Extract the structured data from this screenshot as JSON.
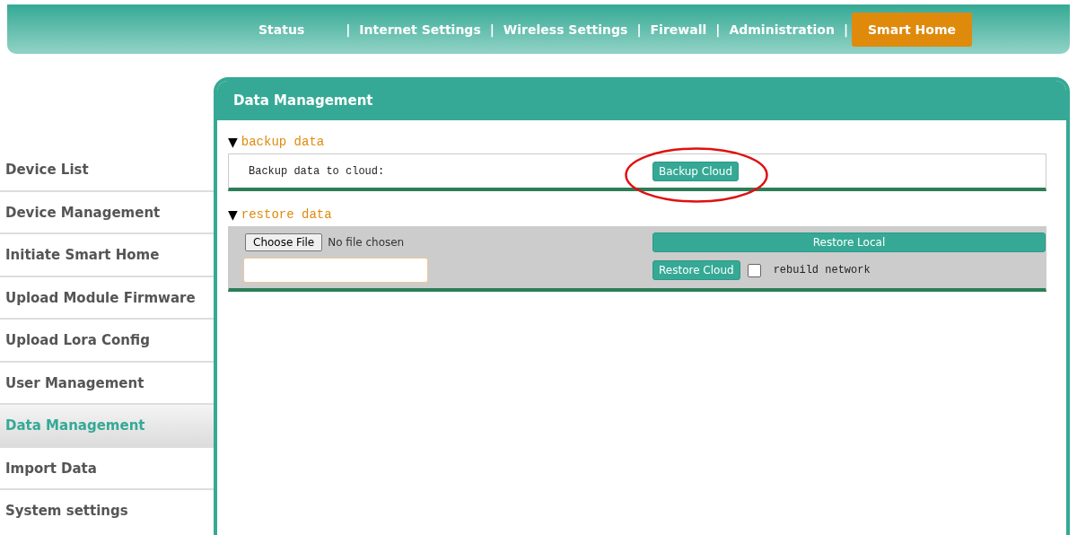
{
  "nav": [
    {
      "label": "Status",
      "selected": false,
      "divider": "|"
    },
    {
      "label": "Internet Settings",
      "selected": false,
      "divider": "|"
    },
    {
      "label": "Wireless Settings",
      "selected": false,
      "divider": "|"
    },
    {
      "label": "Firewall",
      "selected": false,
      "divider": "|"
    },
    {
      "label": "Administration",
      "selected": false,
      "divider": "|"
    },
    {
      "label": "Smart Home",
      "selected": true
    }
  ],
  "sidebar": {
    "items": [
      {
        "label": "Device List",
        "selected": false
      },
      {
        "label": "Device Management",
        "selected": false
      },
      {
        "label": "Initiate Smart Home",
        "selected": false
      },
      {
        "label": "Upload Module Firmware",
        "selected": false
      },
      {
        "label": "Upload Lora Config",
        "selected": false
      },
      {
        "label": "User Management",
        "selected": false
      },
      {
        "label": "Data Management",
        "selected": true
      },
      {
        "label": "Import Data",
        "selected": false
      },
      {
        "label": "System settings",
        "selected": false
      }
    ]
  },
  "panel": {
    "title": "Data Management",
    "backup": {
      "toggle": "▼",
      "title": "backup data",
      "label": "Backup data to cloud:",
      "button": {
        "label": "Backup Cloud",
        "highlighted": true
      }
    },
    "restore": {
      "toggle": "▼",
      "title": "restore data",
      "file_button": "Choose File",
      "file_status": "No file chosen",
      "restore_local": "Restore Local",
      "restore_cloud": "Restore Cloud",
      "rebuild": {
        "label": "rebuild network",
        "checked": false
      }
    }
  }
}
